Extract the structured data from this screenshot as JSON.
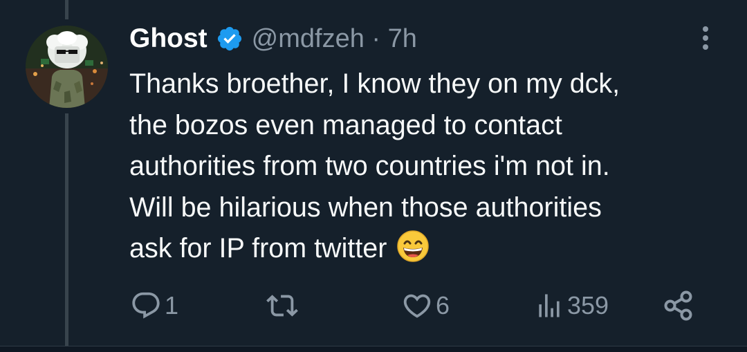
{
  "tweet": {
    "display_name": "Ghost",
    "handle_time": "@mdfzeh · 7h",
    "text_lines": [
      "Thanks broether, I know they on my dck,",
      "the bozos even managed to contact",
      "authorities from two countries i'm not in.",
      "Will be hilarious when those authorities",
      "ask for IP from twitter"
    ],
    "emoji": "grinning-face-emoji"
  },
  "actions": {
    "reply_count": "1",
    "retweet_count": "",
    "like_count": "6",
    "views_count": "359"
  },
  "icons": {
    "verified": "verified-badge-icon",
    "more": "more-options-icon",
    "reply": "reply-icon",
    "retweet": "retweet-icon",
    "like": "heart-icon",
    "views": "views-chart-icon",
    "share": "share-icon"
  },
  "colors": {
    "background": "#15202b",
    "text": "#f7f9f9",
    "muted": "#8b98a5",
    "verified_blue": "#1d9bf0",
    "thread_line": "#38444d"
  }
}
